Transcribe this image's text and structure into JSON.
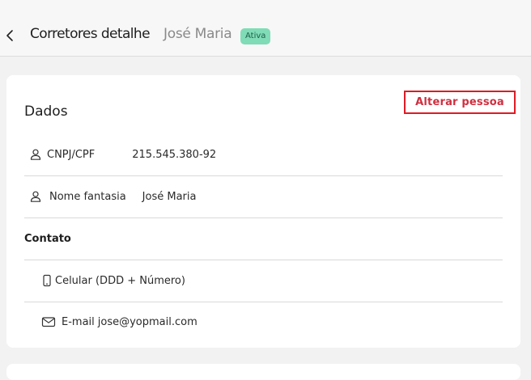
{
  "header": {
    "title": "Corretores detalhe",
    "person_name": "José Maria",
    "status": "Ativa"
  },
  "card": {
    "section_title": "Dados",
    "alter_button_label": "Alterar pessoa",
    "fields": [
      {
        "label": "CNPJ/CPF",
        "value": "215.545.380-92",
        "icon": "person-icon"
      },
      {
        "label": "Nome fantasia",
        "value": "José Maria",
        "icon": "person-icon"
      }
    ],
    "contact_title": "Contato",
    "contacts": [
      {
        "label": "Celular (DDD + Número)",
        "value": "",
        "icon": "phone-icon"
      },
      {
        "label": "E-mail",
        "value": "jose@yopmail.com",
        "icon": "mail-icon"
      }
    ]
  },
  "colors": {
    "status_badge_bg": "#7fdcb6",
    "alter_button_border": "#e01b24",
    "alter_button_text": "#cf2f3f"
  }
}
